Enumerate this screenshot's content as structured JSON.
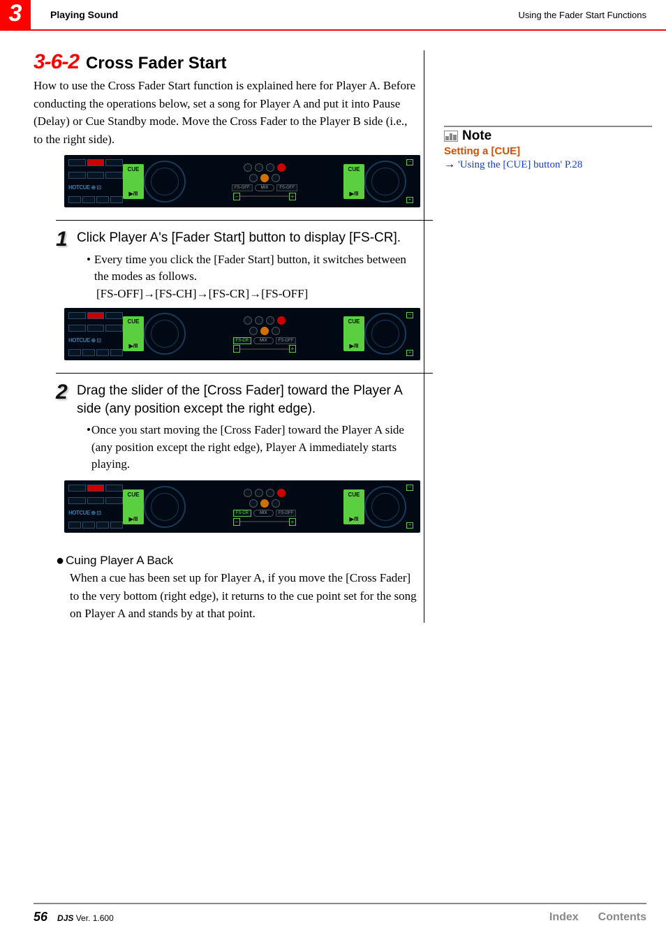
{
  "header": {
    "chapter": "3",
    "section": "Playing Sound",
    "right": "Using the Fader Start Functions"
  },
  "heading": {
    "number": "3-6-2",
    "title": "Cross Fader Start"
  },
  "intro": "How to use the Cross Fader Start function is explained here for Player A. Before conducting the operations below, set a song for Player A and put it into Pause (Delay) or Cue Standby mode. Move the Cross Fader to the Player B side (i.e., to the right side).",
  "ui_labels": {
    "cue": "CUE",
    "play": "▶/II",
    "hotcue": "HOTCUE",
    "mix": "MIX",
    "fs_off": "FS-OFF",
    "fs_cr": "FS-CR",
    "plus": "+",
    "minus": "−"
  },
  "steps": [
    {
      "num": "1",
      "title": "Click Player A's [Fader Start] button to display [FS-CR].",
      "bullet": "Every time you click the [Fader Start] button, it switches between the modes as follows.",
      "sequence": "[FS-OFF]→[FS-CH]→[FS-CR]→[FS-OFF]"
    },
    {
      "num": "2",
      "title": "Drag the slider of the [Cross Fader] toward the Player A side (any position except the right edge).",
      "bullet": "Once you start moving the [Cross Fader] toward the Player A side (any position except the right edge), Player A immediately starts playing."
    }
  ],
  "subsection": {
    "title": "Cuing Player A Back",
    "body": "When a cue has been set up for Player A, if you move the [Cross Fader] to the very bottom (right edge), it returns to the cue point set for the song on Player A and stands by at that point."
  },
  "note": {
    "label": "Note",
    "subject": "Setting a [CUE]",
    "link": "'Using the [CUE] button' P.28"
  },
  "footer": {
    "page": "56",
    "product": "DJS",
    "version_label": "Ver. 1.600",
    "index": "Index",
    "contents": "Contents"
  }
}
